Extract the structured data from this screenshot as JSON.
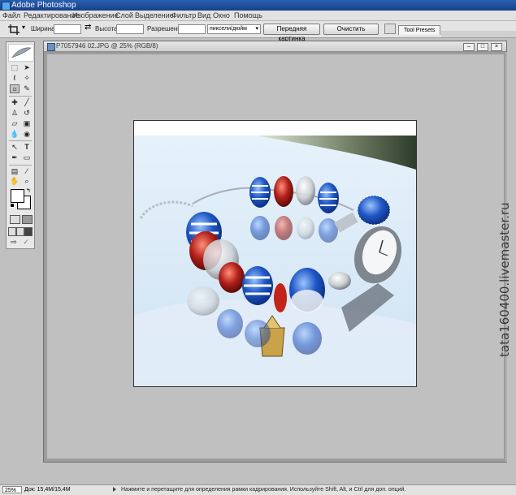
{
  "app": {
    "title": "Adobe Photoshop"
  },
  "menu": [
    "Файл",
    "Редактирование",
    "Изображение",
    "Слой",
    "Выделение",
    "Фильтр",
    "Вид",
    "Окно",
    "Помощь"
  ],
  "options": {
    "width_label": "Ширина:",
    "height_label": "Высота:",
    "resolution_label": "Разрешение:",
    "units_value": "пиксели/дюйм",
    "front_image_button": "Передняя картинка",
    "clear_button": "Очистить",
    "tool_presets_tab": "Tool Presets"
  },
  "tools": {
    "row_icons": [
      "rectangular-marquee",
      "move",
      "lasso",
      "magic-wand",
      "crop",
      "slice",
      "healing-brush",
      "brush",
      "clone-stamp",
      "history-brush",
      "eraser",
      "gradient",
      "blur",
      "dodge",
      "path-selection",
      "type",
      "pen",
      "shape",
      "notes",
      "eyedropper",
      "hand",
      "zoom"
    ],
    "foreground_color": "#ffffff",
    "background_color": "#ffffff",
    "selected_tool": "crop"
  },
  "document": {
    "title": "P7057946 02.JPG @ 25% (RGB/8)",
    "colors": {
      "sky_top": "#d8ecfb",
      "sky_bottom": "#cfe3f5",
      "bead_blue": "#1f57c6",
      "bead_red": "#b2201a",
      "watch_silver": "#c8ccd0",
      "dark_band": "#2d3b2b"
    }
  },
  "status": {
    "zoom": "25%",
    "doc_info": "Док: 15,4M/15,4M",
    "hint": "Нажмите и перетащите для определения рамки кадрирования. Используйте Shift, Alt, и Ctrl для доп. опций."
  },
  "watermark": "tata160400.livemaster.ru"
}
